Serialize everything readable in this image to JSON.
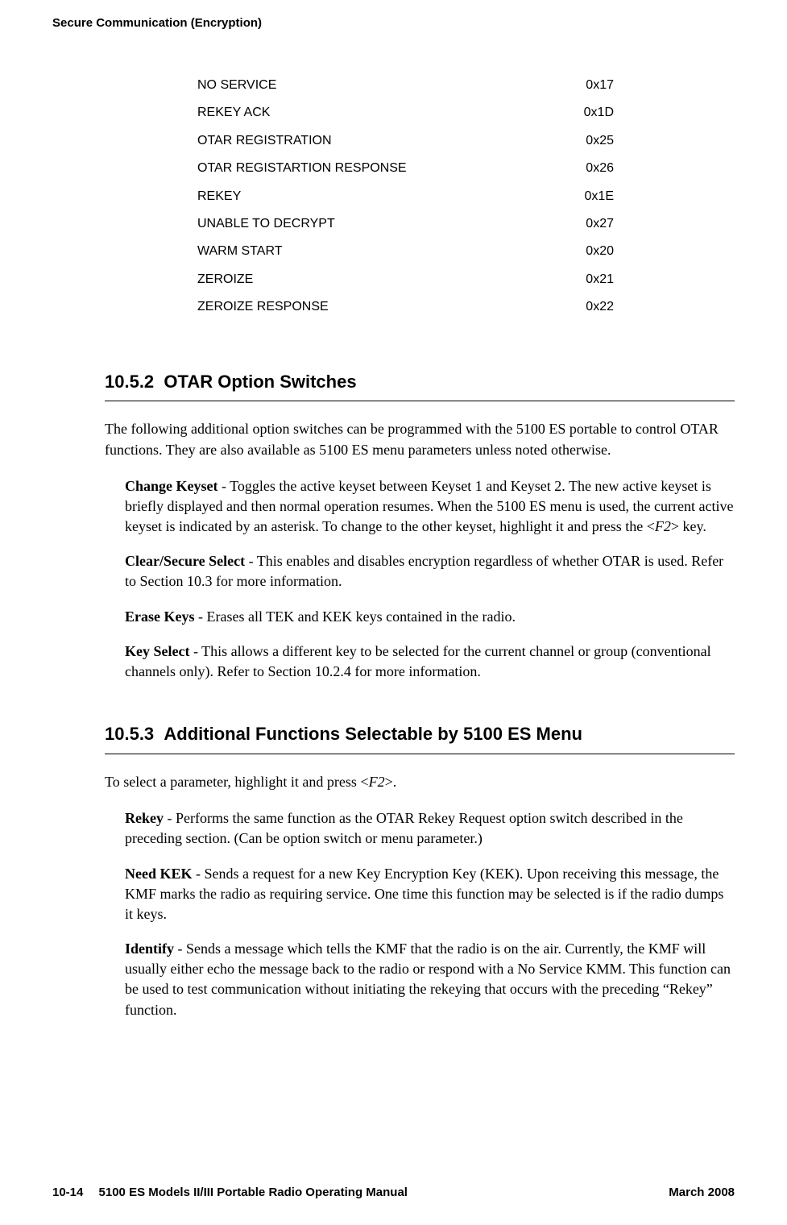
{
  "header": {
    "title": "Secure Communication (Encryption)"
  },
  "table": {
    "rows": [
      {
        "name": "NO SERVICE",
        "code": "0x17"
      },
      {
        "name": "REKEY ACK",
        "code": "0x1D"
      },
      {
        "name": "OTAR REGISTRATION",
        "code": "0x25"
      },
      {
        "name": "OTAR REGISTARTION RESPONSE",
        "code": "0x26"
      },
      {
        "name": "REKEY",
        "code": "0x1E"
      },
      {
        "name": "UNABLE TO DECRYPT",
        "code": "0x27"
      },
      {
        "name": "WARM START",
        "code": "0x20"
      },
      {
        "name": "ZEROIZE",
        "code": "0x21"
      },
      {
        "name": "ZEROIZE RESPONSE",
        "code": "0x22"
      }
    ]
  },
  "sections": {
    "s1": {
      "number": "10.5.2",
      "title": "OTAR Option Switches",
      "intro": "The following additional option switches can be programmed with the 5100 ES portable to control OTAR functions. They are also available as 5100 ES menu parameters unless noted otherwise.",
      "items": {
        "changeKeyset": {
          "label": "Change Keyset",
          "text1": " - Toggles the active keyset between Keyset 1 and Keyset 2. The new active keyset is briefly displayed and then normal operation resumes. When the 5100 ES menu is used, the current active keyset is indicated by an asterisk. To change to the other keyset, highlight it and press the <",
          "keyF2": "F2",
          "text2": "> key."
        },
        "clearSecure": {
          "label": "Clear/Secure Select",
          "text": " - This enables and disables encryption regardless of whether OTAR is used. Refer to Section 10.3 for more information."
        },
        "eraseKeys": {
          "label": "Erase Keys",
          "text": " - Erases all TEK and KEK keys contained in the radio."
        },
        "keySelect": {
          "label": "Key Select",
          "text": " - This allows a different key to be selected for the current channel or group (conventional channels only). Refer to Section 10.2.4 for more information."
        }
      }
    },
    "s2": {
      "number": "10.5.3",
      "title": "Additional Functions Selectable by 5100 ES Menu",
      "introPre": "To select a parameter, highlight it and press <",
      "introKey": "F2",
      "introPost": ">.",
      "items": {
        "rekey": {
          "label": "Rekey",
          "text": " - Performs the same function as the OTAR Rekey Request option switch described in the preceding section. (Can be option switch or menu parameter.)"
        },
        "needKek": {
          "label": "Need KEK",
          "text": " - Sends a request for a new Key Encryption Key (KEK). Upon receiving this message, the KMF marks the radio as requiring service. One time this function may be selected is if the radio dumps it keys."
        },
        "identify": {
          "label": "Identify",
          "text": " - Sends a message which tells the KMF that the radio is on the air. Currently, the KMF will usually either echo the message back to the radio or respond with a No Service KMM. This function can be used to test communication without initiating the rekeying that occurs with the preceding “Rekey” function."
        }
      }
    }
  },
  "footer": {
    "left": "10-14  5100 ES Models II/III Portable Radio Operating Manual",
    "right": "March 2008"
  }
}
